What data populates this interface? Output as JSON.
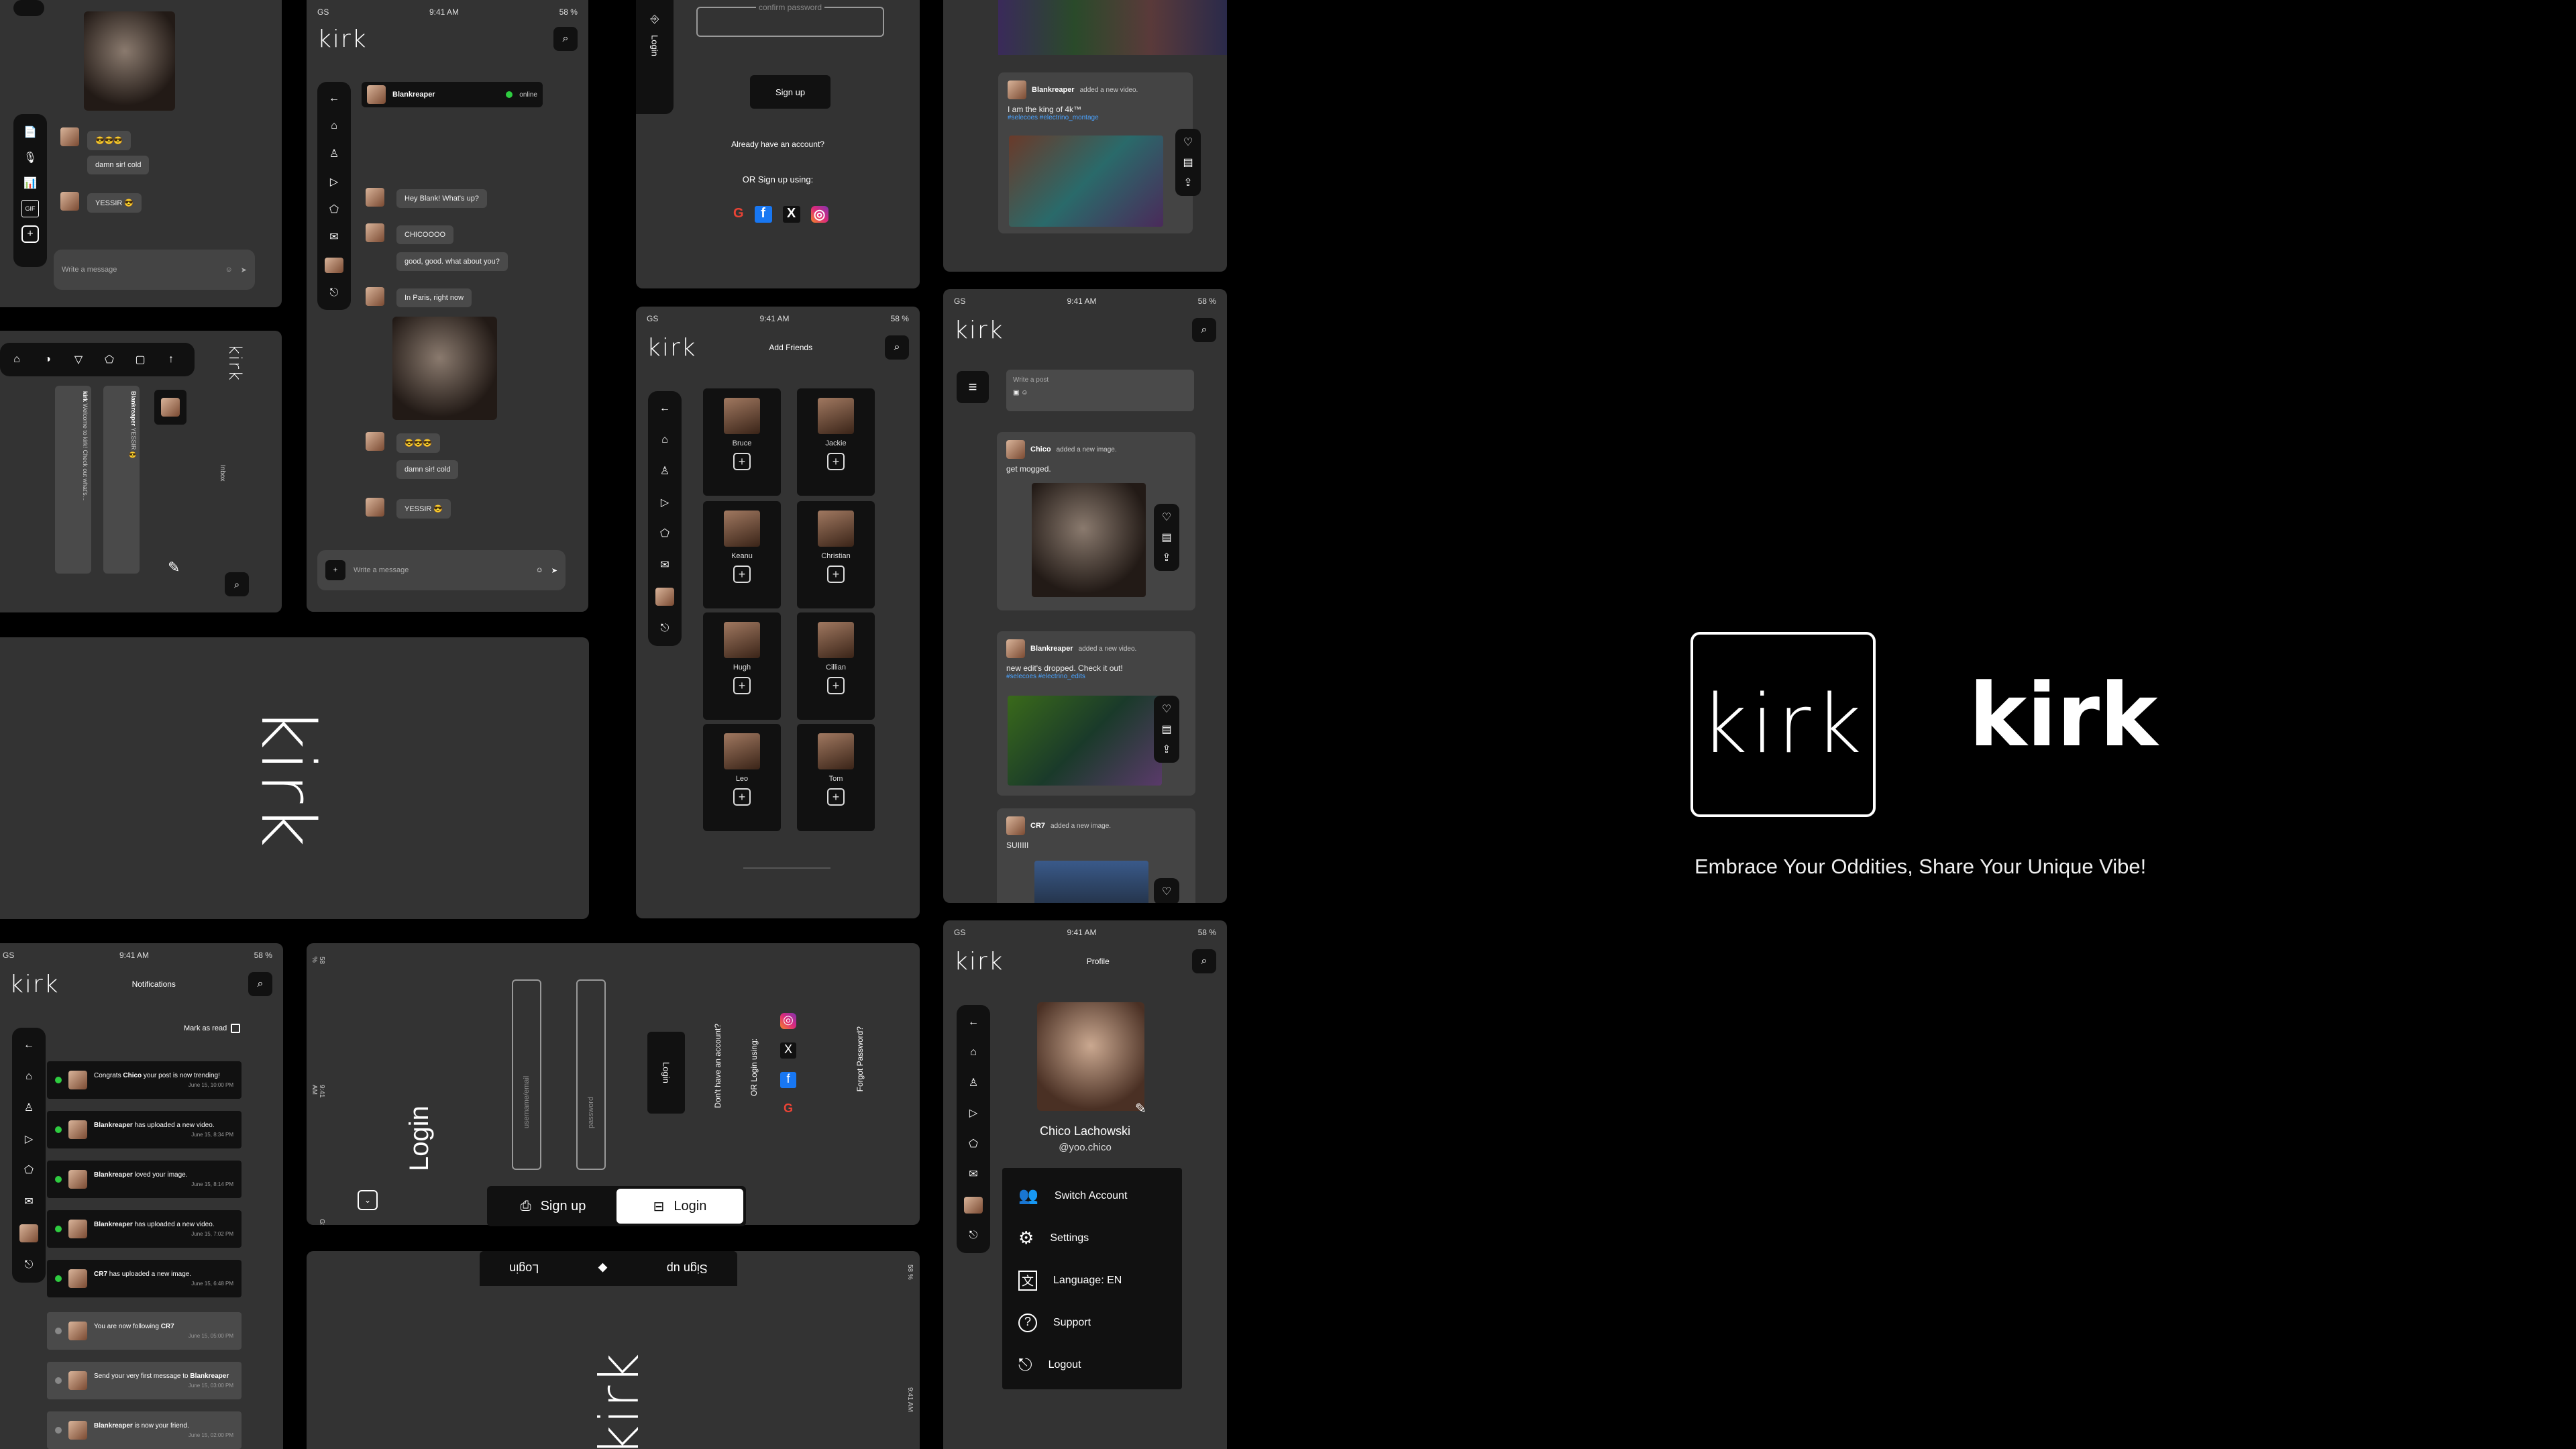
{
  "brand": {
    "name": "kirk",
    "tagline": "Embrace Your Oddities, Share Your Unique Vibe!"
  },
  "status_bar": {
    "carrier": "GS",
    "time": "9:41 AM",
    "battery": "58 %"
  },
  "chat": {
    "contact": "Blankreaper",
    "presence": "online",
    "messages": [
      "Hey Blank! What's up?",
      "CHICOOOO",
      "good, good. what about you?",
      "In Paris, right now",
      "damn sir! cold",
      "YESSIR 😎"
    ],
    "reaction": "😎😎😎",
    "input_placeholder": "Write a message"
  },
  "chat_preview": {
    "messages": [
      "damn sir! cold",
      "YESSIR 😎"
    ],
    "reaction": "😎😎😎",
    "input_placeholder": "Write a message"
  },
  "signup_fragment": {
    "confirm_placeholder": "confirm password",
    "signup_button": "Sign up",
    "have_account": "Already have an account?",
    "or_signup": "OR Sign up using:",
    "side_login": "Login"
  },
  "add_friends": {
    "title": "Add Friends",
    "friends": [
      "Bruce",
      "Jackie",
      "Keanu",
      "Christian",
      "Hugh",
      "Cillian",
      "Leo",
      "Tom"
    ]
  },
  "feed_top": {
    "author": "Blankreaper",
    "action": "added a new video.",
    "text": "I am the king of 4k™",
    "hashtags": "#selecoes #electrino_montage"
  },
  "feed": {
    "composer_placeholder": "Write a post",
    "posts": [
      {
        "author": "Chico",
        "action": "added a new image.",
        "text": "get mogged."
      },
      {
        "author": "Blankreaper",
        "action": "added a new video.",
        "text": "new edit's dropped. Check it out!",
        "hashtags": "#selecoes #electrino_edits"
      },
      {
        "author": "CR7",
        "action": "added a new image.",
        "text": "SUIIIII"
      }
    ]
  },
  "rotated_chatlist": {
    "entries": [
      {
        "name": "kirk",
        "text": "Welcome to kirk! Check out what's..."
      },
      {
        "name": "Blankreaper",
        "text": "YESSIR 😎"
      }
    ],
    "label": "Inbox"
  },
  "notifications": {
    "title": "Notifications",
    "mark_as_read": "Mark as read",
    "items": [
      {
        "who": "",
        "pre": "Congrats",
        "name": "Chico",
        "text": "your post is now trending!",
        "time": "June 15, 10:00 PM",
        "unread": true
      },
      {
        "who": "Blankreaper",
        "pre": "",
        "name": "",
        "text": "has uploaded a new video.",
        "time": "June 15, 8:34 PM",
        "unread": true
      },
      {
        "who": "Blankreaper",
        "pre": "",
        "name": "",
        "text": "loved your image.",
        "time": "June 15, 8:14 PM",
        "unread": true
      },
      {
        "who": "Blankreaper",
        "pre": "",
        "name": "",
        "text": "has uploaded a new video.",
        "time": "June 15, 7:02 PM",
        "unread": true
      },
      {
        "who": "CR7",
        "pre": "",
        "name": "",
        "text": "has uploaded a new image.",
        "time": "June 15, 6:48 PM",
        "unread": true
      },
      {
        "who": "",
        "pre": "You are now following",
        "name": "CR7",
        "text": "",
        "time": "June 15, 05:00 PM",
        "unread": false
      },
      {
        "who": "",
        "pre": "Send your very first message to",
        "name": "Blankreaper",
        "text": "",
        "time": "June 15, 03:00 PM",
        "unread": false
      },
      {
        "who": "Blankreaper",
        "pre": "",
        "name": "",
        "text": "is now your friend.",
        "time": "June 15, 02:00 PM",
        "unread": false
      }
    ]
  },
  "login": {
    "title": "Login",
    "username_placeholder": "username/email",
    "password_placeholder": "password",
    "login_button": "Login",
    "no_account": "Don't have an account?",
    "or_login": "OR Login using:",
    "forgot": "Forgot Password?"
  },
  "toggle": {
    "signup": "Sign up",
    "login": "Login"
  },
  "profile": {
    "title": "Profile",
    "name": "Chico Lachowski",
    "handle": "@yoo.chico",
    "menu": [
      "Switch Account",
      "Settings",
      "Language: EN",
      "Support",
      "Logout"
    ]
  },
  "colors": {
    "bg": "#000000",
    "card": "#333333",
    "dark": "#111111",
    "online": "#2ecc40",
    "link": "#4aa3ff"
  }
}
